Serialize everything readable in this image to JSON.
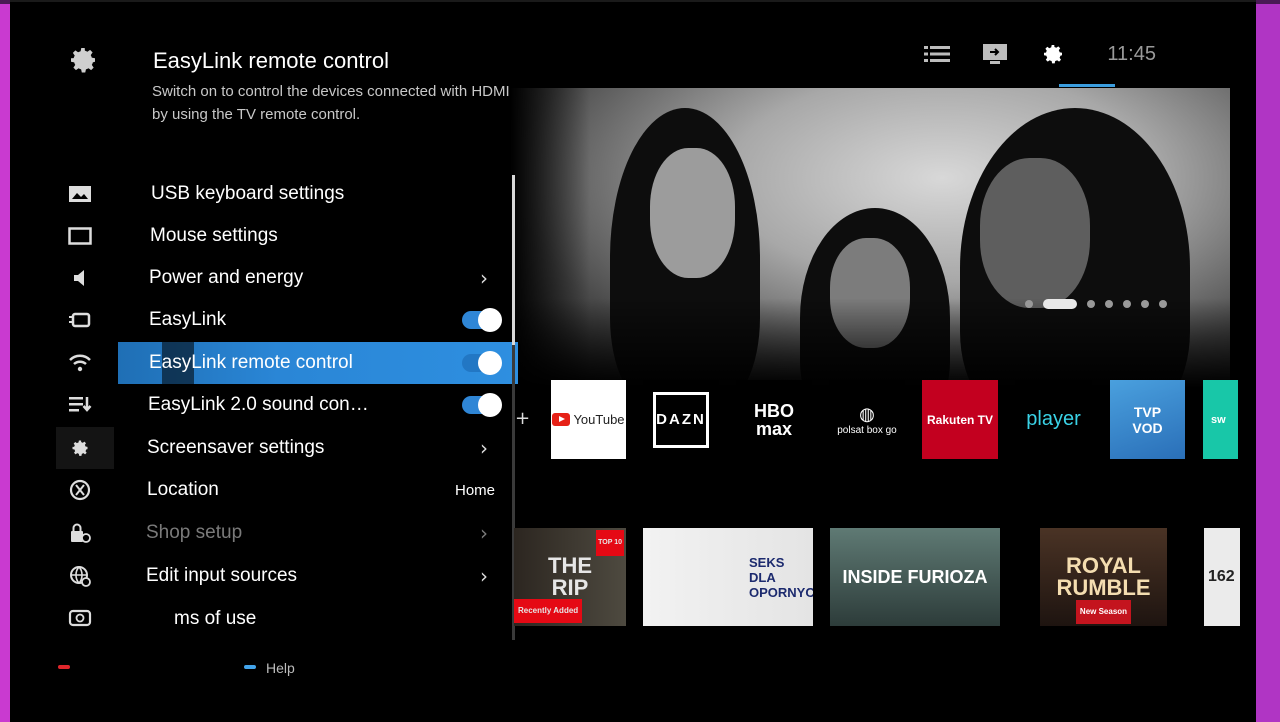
{
  "header": {
    "title": "EasyLink remote control",
    "description": "Switch on to control the devices connected with HDMI by using the TV remote control."
  },
  "topbar": {
    "icons": [
      "list-icon",
      "input-source-icon",
      "settings-gear-icon"
    ],
    "clock": "11:45"
  },
  "menu": {
    "items": [
      {
        "label": "USB keyboard settings",
        "icon": "picture-icon"
      },
      {
        "label": "Mouse settings",
        "icon": "screen-icon"
      },
      {
        "label": "Power and energy",
        "icon": "speaker-icon",
        "chevron": "›"
      },
      {
        "label": "EasyLink",
        "icon": "battery-icon",
        "toggle": true
      },
      {
        "label": "EasyLink remote control",
        "icon": "wifi-icon",
        "toggle": true,
        "selected": true
      },
      {
        "label": "EasyLink 2.0 sound con…",
        "icon": "list-download-icon",
        "toggle": true
      },
      {
        "label": "Screensaver settings",
        "icon": "gear-icon",
        "chevron": "›"
      },
      {
        "label": "Location",
        "icon": "accessibility-icon",
        "value": "Home"
      },
      {
        "label": "Shop setup",
        "icon": "lock-icon",
        "chevron": "›",
        "disabled": true
      },
      {
        "label": "Edit input sources",
        "icon": "globe-icon",
        "chevron": "›"
      },
      {
        "label": "ms of use",
        "icon": "support-icon"
      }
    ]
  },
  "apps": [
    "YouTube",
    "DAZN",
    "HBO max",
    "polsat box go",
    "Rakuten TV",
    "player",
    "TVP VOD",
    "sw"
  ],
  "content": [
    {
      "title": "THE RIP",
      "badge": "TOP 10",
      "sub": "Recently Added"
    },
    {
      "title": "SEKS DLA OPORNYCH"
    },
    {
      "title": "INSIDE FURIOZA"
    },
    {
      "title": "ROYAL RUMBLE",
      "sub": "New Season"
    },
    {
      "title": "162"
    }
  ],
  "footer": {
    "help": "Help"
  },
  "colors": {
    "accent": "#2a86d6",
    "frame": "#c93ad0"
  }
}
